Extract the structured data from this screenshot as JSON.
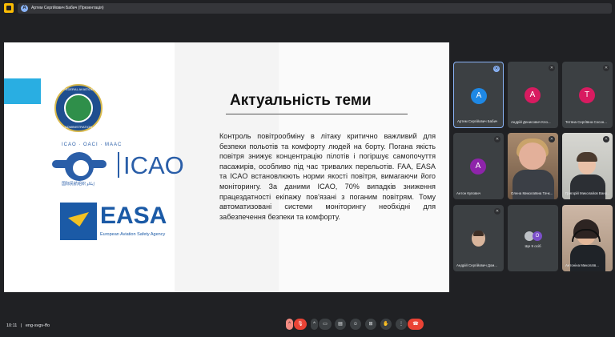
{
  "presentation_chip": {
    "label": "Артем Сергійович Бабич (Презентація)",
    "avatar_letter": "A"
  },
  "slide": {
    "title": "Актуальність теми",
    "body": "Контроль повітрообміну в літаку критично важливий для безпеки польотів та комфорту людей на борту. Погана якість повітря знижує концентрацію пілотів і погіршує самопочуття пасажирів, особливо під час тривалих перельотів. FAA, EASA та ICAO встановлюють норми якості повітря, вимагаючи його моніторингу. За даними ICAO, 70% випадків зниження працездатності екіпажу пов'язані з поганим повітрям. Тому автоматизовані системи моніторингу необхідні для забезпечення безпеки та комфорту.",
    "logos": {
      "faa_top": "FEDERAL AVIATION",
      "faa_bottom": "ADMINISTRATION",
      "icao_caption": "ICAO · OACI · MAAC",
      "icao_sub": "国际民航组织   إيكاو",
      "icao_name": "ICAO",
      "easa_name": "EASA",
      "easa_sub": "European Aviation Safety Agency"
    }
  },
  "participants": [
    {
      "name": "Артем Сергійович Бабич",
      "letter": "A",
      "color": "#1e88e5",
      "speaking": true
    },
    {
      "name": "Андрій Денисович Кло...",
      "letter": "A",
      "color": "#d81b60",
      "speaking": false
    },
    {
      "name": "Тетяна Сергіївна Сосон...",
      "letter": "T",
      "color": "#d81b60",
      "speaking": false
    },
    {
      "name": "Антон Купович",
      "letter": "A",
      "color": "#8e24aa",
      "speaking": false
    },
    {
      "name": "Олена Миколаївна Тачк...",
      "letter": "",
      "color": "",
      "speaking": false
    },
    {
      "name": "Григорій Миколайов Вану...",
      "letter": "",
      "color": "",
      "speaking": false
    },
    {
      "name": "Андрій Сергійович Дом...",
      "letter": "",
      "color": "",
      "speaking": false
    },
    {
      "name": "Ще 9 осіб",
      "letter": "O",
      "color": "#7b4fc9",
      "speaking": false
    },
    {
      "name": "Антоніна Миколаїв...",
      "letter": "",
      "color": "",
      "speaking": false
    }
  ],
  "bottombar": {
    "time": "10:11",
    "meeting_code": "eng-svgv-ffo",
    "icons": [
      "chevron-up-icon",
      "mic-off-icon",
      "chevron-up-icon",
      "camera-off-icon",
      "captions-icon",
      "emoji-icon",
      "present-icon",
      "raise-hand-icon",
      "more-icon",
      "end-call-icon"
    ]
  }
}
